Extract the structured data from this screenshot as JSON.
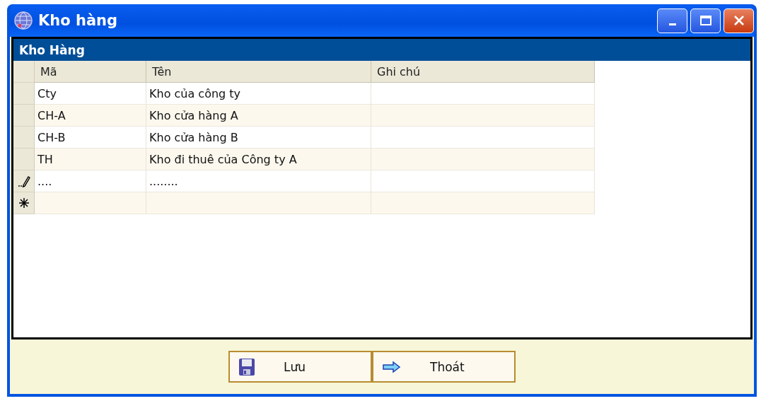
{
  "window": {
    "title": "Kho hàng"
  },
  "panel": {
    "title": "Kho Hàng"
  },
  "table": {
    "columns": [
      "Mã",
      "Tên",
      "Ghi chú"
    ],
    "rows": [
      {
        "kind": "data",
        "cells": [
          "Cty",
          "Kho của công ty",
          ""
        ]
      },
      {
        "kind": "data",
        "cells": [
          "CH-A",
          "Kho cửa hàng A",
          ""
        ]
      },
      {
        "kind": "data",
        "cells": [
          "CH-B",
          "Kho cửa hàng B",
          ""
        ]
      },
      {
        "kind": "data",
        "cells": [
          "TH",
          "Kho đi thuê của Công ty A",
          ""
        ]
      },
      {
        "kind": "editing",
        "cells": [
          "....",
          "........",
          ""
        ]
      },
      {
        "kind": "new",
        "cells": [
          "",
          "",
          ""
        ]
      }
    ]
  },
  "buttons": [
    {
      "kind": "save",
      "label": "Lưu"
    },
    {
      "kind": "exit",
      "label": "Thoát"
    }
  ]
}
